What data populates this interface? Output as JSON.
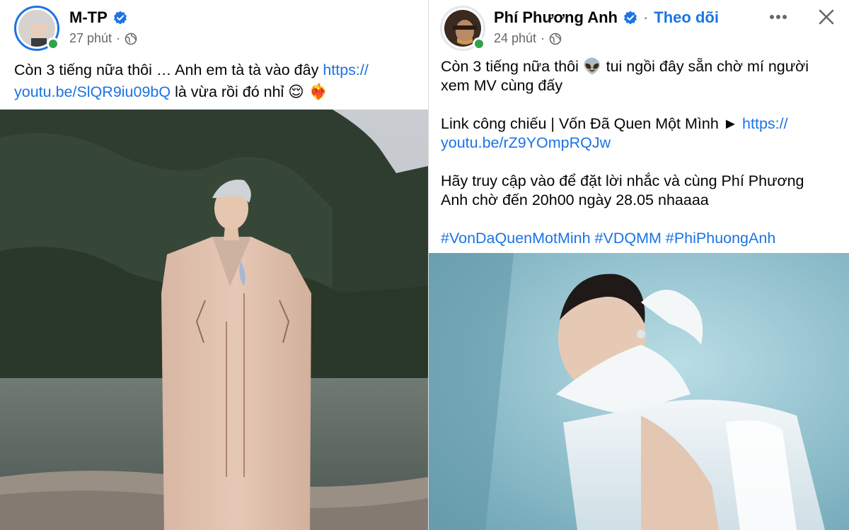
{
  "left_post": {
    "author": "M-TP",
    "time": "27 phút",
    "caption_text": "Còn 3 tiếng nữa thôi … Anh em tà tà vào đây ",
    "caption_link_1": "https://",
    "caption_link_2": "youtu.be/SlQR9iu09bQ",
    "caption_tail": " là vừa rồi đó nhỉ ",
    "caption_emoji": "😌 ❤️‍🔥",
    "colors": {
      "verified": "#1b74e4",
      "online": "#31a24c"
    }
  },
  "right_post": {
    "author": "Phí Phương Anh",
    "dot": "·",
    "follow_label": "Theo dõi",
    "time": "24 phút",
    "line1": "Còn 3 tiếng nữa thôi 👽 tui ngồi đây sẵn chờ mí người",
    "line2": "xem MV cùng đấy",
    "link_label": "Link công chiếu | Vốn Đã Quen Một Mình ► ",
    "link_part1": "https://",
    "link_part2": "youtu.be/rZ9YOmpRQJw",
    "line3": "Hãy truy cập vào để đặt lời nhắc và cùng Phí Phương",
    "line4": "Anh chờ đến 20h00 ngày 28.05 nhaaaa",
    "hashtags": "#VonDaQuenMotMinh #VDQMM #PhiPhuongAnh",
    "icons": {
      "more": "more-horizontal-icon",
      "close": "close-icon"
    }
  }
}
